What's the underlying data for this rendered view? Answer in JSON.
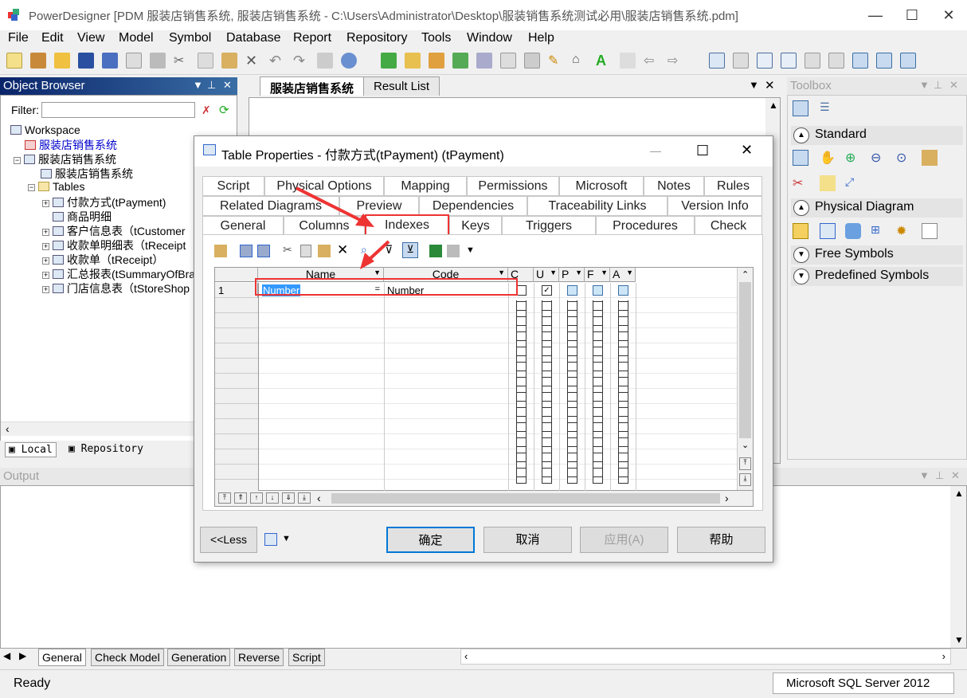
{
  "app": {
    "title": "PowerDesigner [PDM 服装店销售系统, 服装店销售系统 - C:\\Users\\Administrator\\Desktop\\服装销售系统测试必用\\服装店销售系统.pdm]",
    "minimize_glyph": "—",
    "maximize_glyph": "☐",
    "close_glyph": "✕"
  },
  "menu": [
    "File",
    "Edit",
    "View",
    "Model",
    "Symbol",
    "Database",
    "Report",
    "Repository",
    "Tools",
    "Window",
    "Help"
  ],
  "object_browser": {
    "title": "Object Browser",
    "filter_label": "Filter:",
    "tree": [
      {
        "label": "Workspace",
        "level": 0
      },
      {
        "label": "服装店销售系统",
        "level": 1,
        "color": "#0000cc"
      },
      {
        "label": "服装店销售系统",
        "level": 1
      },
      {
        "label": "服装店销售系统",
        "level": 2
      },
      {
        "label": "Tables",
        "level": 2
      },
      {
        "label": "付款方式(tPayment)",
        "level": 3
      },
      {
        "label": "商品明细",
        "level": 3
      },
      {
        "label": "客户信息表（tCustomer",
        "level": 3
      },
      {
        "label": "收款单明细表（tReceipt",
        "level": 3
      },
      {
        "label": "收款单（tReceipt）",
        "level": 3
      },
      {
        "label": "汇总报表(tSummaryOfBra",
        "level": 3
      },
      {
        "label": "门店信息表（tStoreShop",
        "level": 3
      }
    ],
    "tabs": [
      "Local",
      "Repository"
    ]
  },
  "document": {
    "tabs": [
      "服装店销售系统",
      "Result List"
    ]
  },
  "toolbox": {
    "title": "Toolbox",
    "sections": [
      "Standard",
      "Physical Diagram",
      "Free Symbols",
      "Predefined Symbols"
    ]
  },
  "output": {
    "title": "Output",
    "tabs": [
      "General",
      "Check Model",
      "Generation",
      "Reverse",
      "Script"
    ]
  },
  "status": {
    "left": "Ready",
    "right": "Microsoft SQL Server 2012"
  },
  "dialog": {
    "title": "Table Properties - 付款方式(tPayment) (tPayment)",
    "tabs_row1": [
      "Script",
      "Physical Options",
      "Mapping",
      "Permissions",
      "Microsoft",
      "Notes",
      "Rules"
    ],
    "tabs_row2": [
      "Related Diagrams",
      "Preview",
      "Dependencies",
      "Traceability Links",
      "Version Info"
    ],
    "tabs_row3": [
      "General",
      "Columns",
      "Indexes",
      "Keys",
      "Triggers",
      "Procedures",
      "Check"
    ],
    "active_tab": "Indexes",
    "grid": {
      "columns": [
        "Name",
        "Code",
        "C",
        "U",
        "P",
        "F",
        "A"
      ],
      "rows": [
        {
          "num": "1",
          "name": "Number",
          "code": "Number",
          "C": false,
          "U": true,
          "P": false,
          "F": false,
          "A": false
        }
      ]
    },
    "less_button": "<<Less",
    "buttons": [
      "确定",
      "取消",
      "应用(A)",
      "帮助"
    ]
  }
}
